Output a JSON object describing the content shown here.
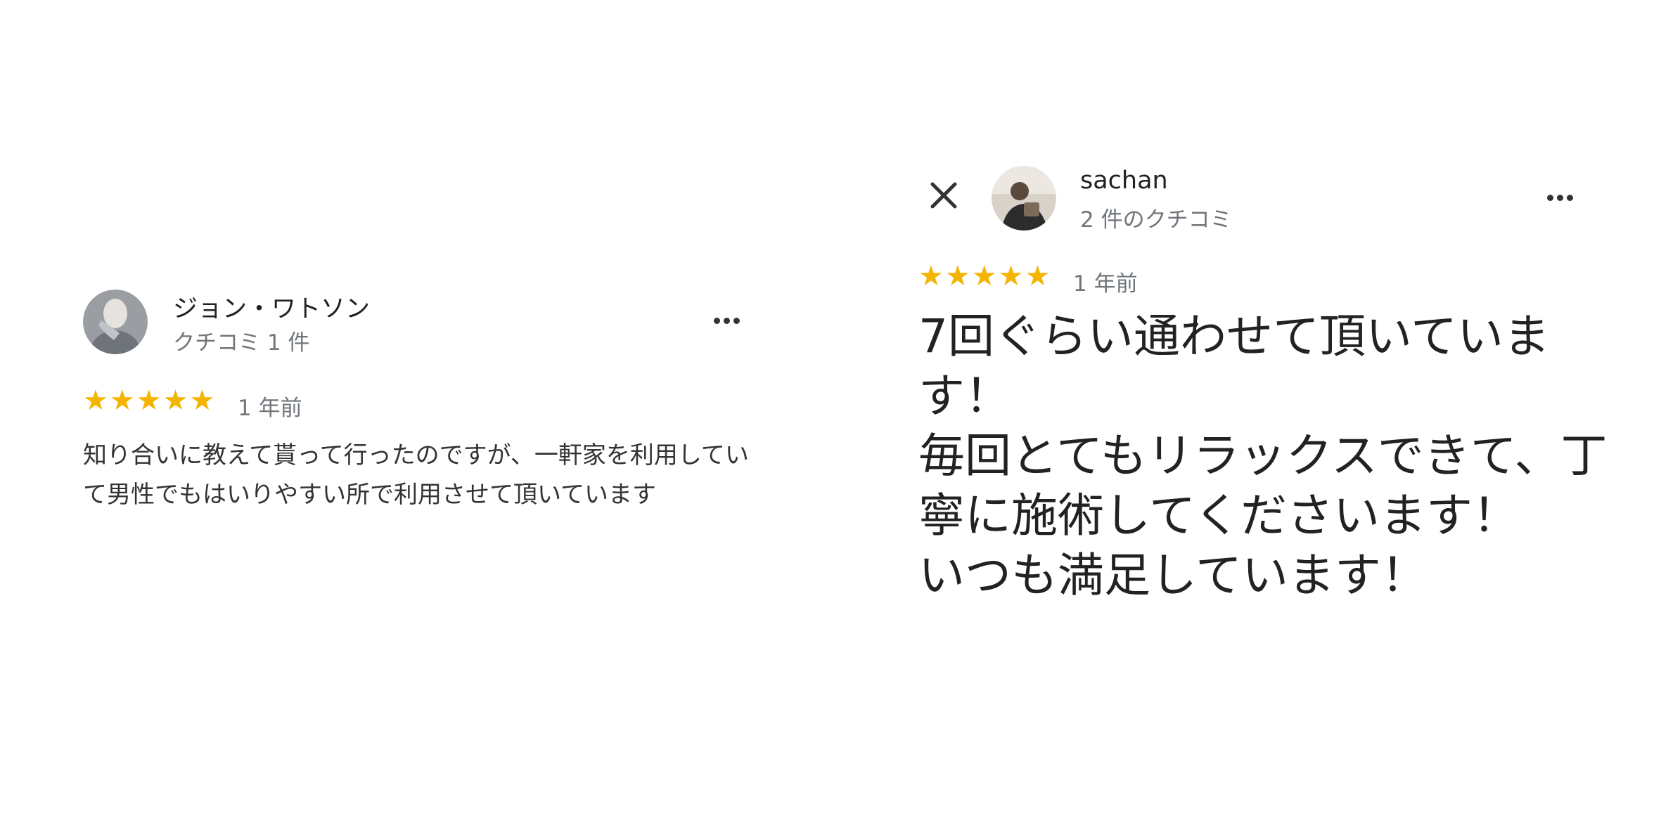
{
  "reviews": [
    {
      "reviewer_name": "ジョン・ワトソン",
      "reviewer_meta": "クチコミ 1 件",
      "rating": 5,
      "stars": [
        "★",
        "★",
        "★",
        "★",
        "★"
      ],
      "time": "1 年前",
      "text": "知り合いに教えて貰って行ったのですが、一軒家を利用していて男性でもはいりやすい所で利用させて頂いています"
    },
    {
      "reviewer_name": "sachan",
      "reviewer_meta": "2 件のクチコミ",
      "rating": 5,
      "stars": [
        "★",
        "★",
        "★",
        "★",
        "★"
      ],
      "time": "1 年前",
      "text": "7回ぐらい通わせて頂いています！\n毎回とてもリラックスできて、丁寧に施術してくださいます！\nいつも満足しています！"
    }
  ],
  "icons": {
    "more": "more-horizontal-icon",
    "close": "close-icon",
    "star": "star-icon"
  },
  "colors": {
    "star": "#f4b400",
    "meta_text": "#70757a"
  }
}
